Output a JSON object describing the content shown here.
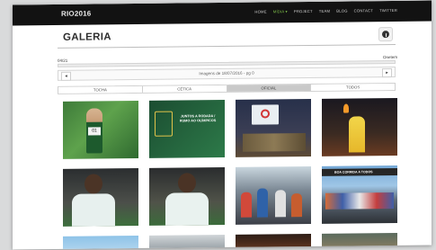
{
  "header": {
    "brand": "RIO2016",
    "nav": [
      {
        "label": "HOME",
        "active": false
      },
      {
        "label": "MÍDIA ▾",
        "active": true
      },
      {
        "label": "PROJECT",
        "active": false
      },
      {
        "label": "TEAM",
        "active": false
      },
      {
        "label": "BLOG",
        "active": false
      },
      {
        "label": "CONTACT",
        "active": false
      },
      {
        "label": "TWITTER",
        "active": false
      }
    ]
  },
  "page": {
    "title": "GALERIA",
    "counter": "04/21",
    "right_label": "Onetem",
    "pager_text": "Imagens de 18/07/2016 - pg 0",
    "prev_label": "◂",
    "next_label": "▸",
    "progress_fraction": 0.0
  },
  "tabs": [
    {
      "label": "TOCHA",
      "active": false
    },
    {
      "label": "CÉTICA",
      "active": false
    },
    {
      "label": "OFICIAL",
      "active": true
    },
    {
      "label": "TODOS",
      "active": false
    }
  ],
  "gallery": [
    {
      "name": "photo-runner-green",
      "text": ""
    },
    {
      "name": "photo-poster-green",
      "text": "JUNTOS A RODADA / RUMO AO OLÍMPICOS"
    },
    {
      "name": "photo-stage-event",
      "text": ""
    },
    {
      "name": "photo-torch-night",
      "text": ""
    },
    {
      "name": "photo-man-bottle",
      "text": ""
    },
    {
      "name": "photo-man-smiling-1",
      "text": ""
    },
    {
      "name": "photo-man-smiling-2",
      "text": ""
    },
    {
      "name": "photo-runners-crowd",
      "text": ""
    },
    {
      "name": "photo-race-banner",
      "text": "BOA CORRIDA A TODOS"
    },
    {
      "name": "photo-bottom-1",
      "text": ""
    },
    {
      "name": "photo-bottom-2",
      "text": ""
    },
    {
      "name": "photo-bottom-3",
      "text": ""
    },
    {
      "name": "photo-bottom-4",
      "text": ""
    }
  ]
}
